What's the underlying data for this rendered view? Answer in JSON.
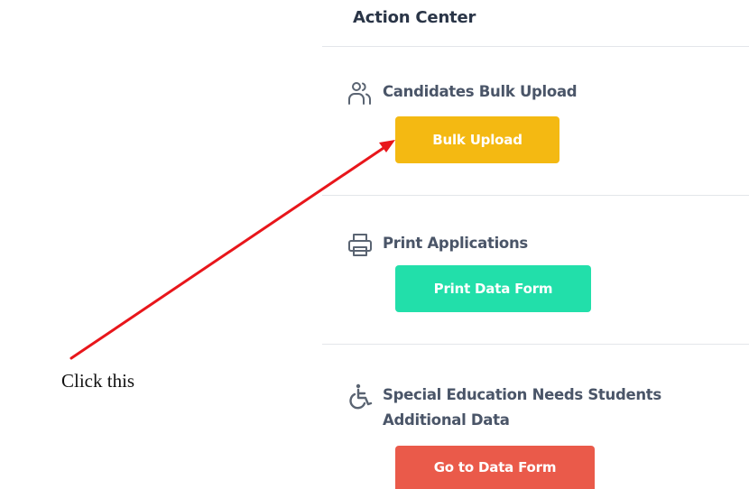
{
  "panel": {
    "title": "Action Center",
    "sections": [
      {
        "label": "Candidates Bulk Upload",
        "icon": "users-icon",
        "button_label": "Bulk Upload",
        "button_color": "#f4b912"
      },
      {
        "label": "Print Applications",
        "icon": "printer-icon",
        "button_label": "Print Data Form",
        "button_color": "#22dfaa"
      },
      {
        "label_line1": "Special Education Needs Students",
        "label_line2": "Additional Data",
        "icon": "wheelchair-icon",
        "button_label": "Go to Data Form",
        "button_color": "#ea5a4a"
      }
    ]
  },
  "annotation": {
    "text": "Click this",
    "arrow_color": "#e8161b"
  }
}
